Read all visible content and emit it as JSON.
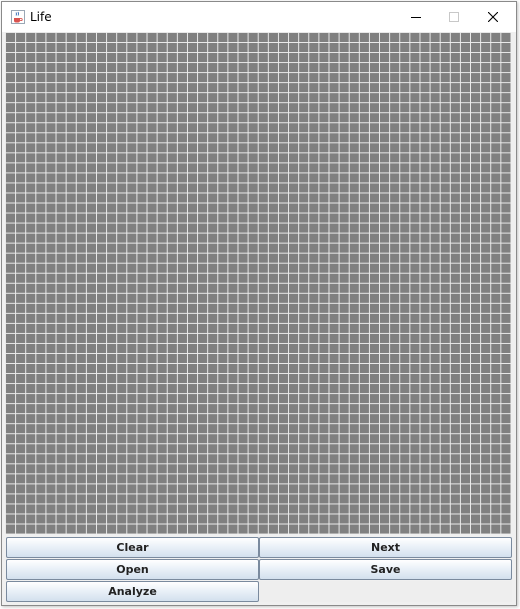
{
  "window": {
    "title": "Life",
    "icon": "java-coffee-cup-icon",
    "controls": [
      "minimize-icon",
      "maximize-icon",
      "close-icon"
    ]
  },
  "grid": {
    "columns": 50,
    "rows": 50,
    "cell_color": "#808080",
    "line_color": "#ececec"
  },
  "buttons": {
    "clear": "Clear",
    "next": "Next",
    "open": "Open",
    "save": "Save",
    "analyze": "Analyze"
  }
}
